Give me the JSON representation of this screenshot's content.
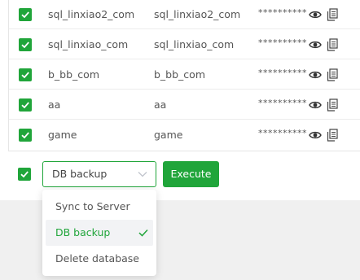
{
  "table": {
    "rows": [
      {
        "name": "sql_linxiao2_com",
        "user": "sql_linxiao2_com",
        "password": "**********"
      },
      {
        "name": "sql_linxiao_com",
        "user": "sql_linxiao_com",
        "password": "**********"
      },
      {
        "name": "b_bb_com",
        "user": "b_bb_com",
        "password": "**********"
      },
      {
        "name": "aa",
        "user": "aa",
        "password": "**********"
      },
      {
        "name": "game",
        "user": "game",
        "password": "**********"
      }
    ]
  },
  "footer": {
    "select_value": "DB backup",
    "execute_label": "Execute"
  },
  "dropdown": {
    "options": [
      {
        "label": "Sync to Server"
      },
      {
        "label": "DB backup"
      },
      {
        "label": "Delete database"
      }
    ]
  },
  "colors": {
    "accent": "#20a53a",
    "page_background": "#f0f0f0"
  },
  "icons": {
    "row_checkbox": "checkbox-checked-icon",
    "show_password": "eye-icon",
    "copy_password": "copy-icon",
    "select_chevron": "chevron-down-icon",
    "selected_option": "checkmark-icon"
  }
}
